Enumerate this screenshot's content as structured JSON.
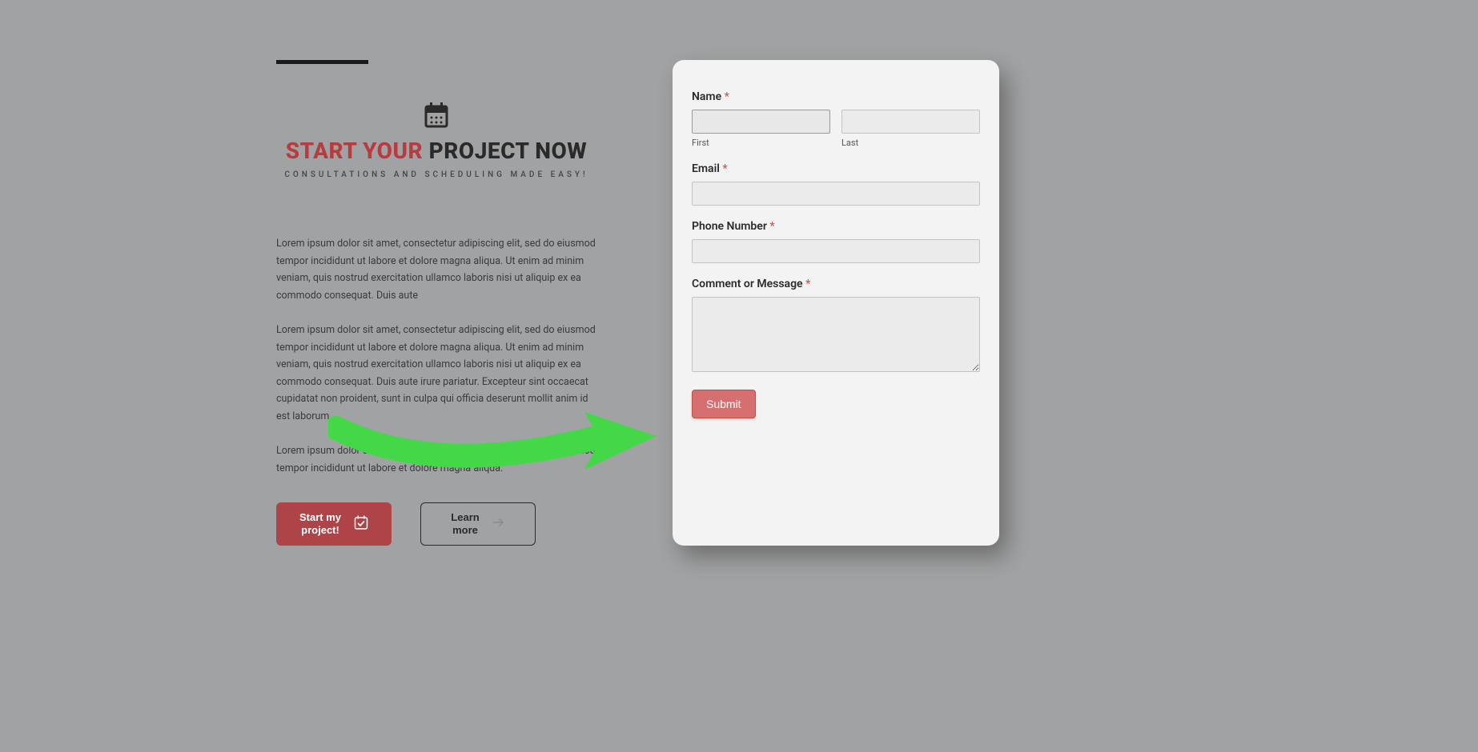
{
  "left": {
    "heading_red": "START YOUR ",
    "heading_dark": "PROJECT NOW",
    "subheading": "CONSULTATIONS AND SCHEDULING MADE EASY!",
    "para1": "Lorem ipsum dolor sit amet, consectetur adipiscing elit, sed do eiusmod tempor incididunt ut labore et dolore magna aliqua. Ut enim ad minim veniam, quis nostrud exercitation ullamco laboris nisi ut aliquip ex ea commodo consequat. Duis aute",
    "para2": "Lorem ipsum dolor sit amet, consectetur adipiscing elit, sed do eiusmod tempor incididunt ut labore et dolore magna aliqua. Ut enim ad minim veniam, quis nostrud exercitation ullamco laboris nisi ut aliquip ex ea commodo consequat. Duis aute irure  pariatur. Excepteur sint occaecat cupidatat non proident, sunt in culpa qui officia deserunt mollit anim id est laborum.",
    "para3": "Lorem ipsum dolor sit amet, consectetur adipiscing elit, sed do eiusmod tempor incididunt ut labore et dolore magna aliqua.",
    "btn_primary": "Start my\nproject!",
    "btn_secondary": "Learn\nmore"
  },
  "form": {
    "name_label": "Name",
    "first_sub": "First",
    "last_sub": "Last",
    "email_label": "Email",
    "phone_label": "Phone Number",
    "message_label": "Comment or Message",
    "submit": "Submit",
    "required_mark": "*"
  }
}
